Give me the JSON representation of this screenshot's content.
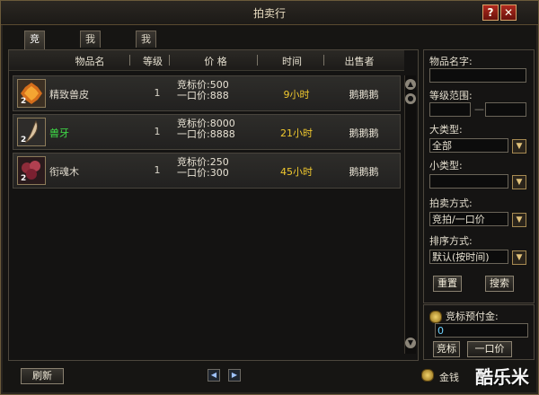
{
  "window": {
    "title": "拍卖行",
    "help_label": "?",
    "close_label": "✕"
  },
  "tabs": [
    "竞拍物品",
    "我的竞标",
    "我的拍卖"
  ],
  "columns": {
    "name": "物品名",
    "level": "等级",
    "price": "价 格",
    "time": "时间",
    "seller": "出售者"
  },
  "items": [
    {
      "name": "精致兽皮",
      "count": "2",
      "level": "1",
      "bid": "竞标价:500",
      "buyout": "一口价:888",
      "time": "9小时",
      "seller": "鹅鹅鹅",
      "icon": "leather-icon"
    },
    {
      "name": "兽牙",
      "count": "2",
      "level": "1",
      "bid": "竞标价:8000",
      "buyout": "一口价:8888",
      "time": "21小时",
      "seller": "鹅鹅鹅",
      "icon": "fang-icon"
    },
    {
      "name": "衔魂木",
      "count": "2",
      "level": "1",
      "bid": "竞标价:250",
      "buyout": "一口价:300",
      "time": "45小时",
      "seller": "鹅鹅鹅",
      "icon": "soul-wood-icon"
    }
  ],
  "filters": {
    "item_name_label": "物品名字:",
    "level_range_label": "等级范围:",
    "level_min": "",
    "level_max": "",
    "level_dash": "—",
    "major_type_label": "大类型:",
    "major_type_value": "全部",
    "minor_type_label": "小类型:",
    "minor_type_value": "",
    "auction_mode_label": "拍卖方式:",
    "auction_mode_value": "竞拍/一口价",
    "sort_label": "排序方式:",
    "sort_value": "默认(按时间)",
    "reset_label": "重置",
    "search_label": "搜索"
  },
  "bid": {
    "prepay_label": "竞标预付金:",
    "prepay_value": "0",
    "bid_button": "竞标",
    "buyout_button": "一口价"
  },
  "footer": {
    "refresh_label": "刷新",
    "gold_label": "金钱",
    "watermark": "酷乐米"
  },
  "colors": {
    "time": "#f0c82e",
    "rare_item": "#3fe048",
    "frame": "#6b5a3a"
  }
}
